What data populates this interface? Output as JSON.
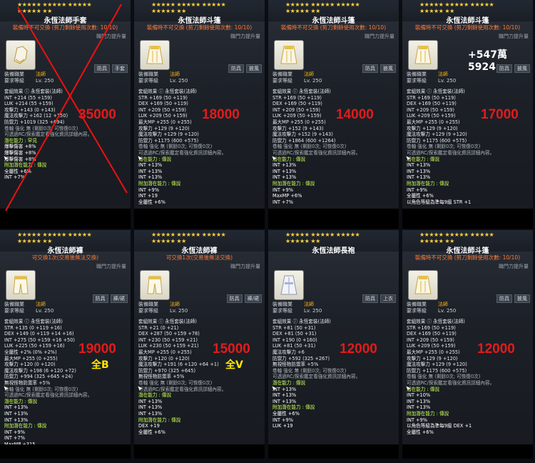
{
  "cards": [
    {
      "stars": "★★★★★ ★★★★★ ★★★★★\n★★★★★ ★★",
      "title": "永恆法師手套",
      "subtitle": "裝備時不可交換 (剪刀剩餘使用次數: 10/10)",
      "upgrade": "職門力提升量",
      "tags": [
        "防具",
        "手套"
      ],
      "req_job_label": "裝備職業",
      "req_job": "法師",
      "req_lv_label": "要求等級",
      "req_lv": "Lv. 250",
      "price": "35000",
      "stat_text": "",
      "allstat_text": "",
      "crossed": true,
      "lines": [
        "套組效果 ⓘ   永恆套裝(法師)",
        "INT +214 (55 +159)",
        "LUK +214 (55 +159)",
        "攻擊力 +143 (0 +143)",
        "魔法攻擊力 +162 (12 +150)",
        "防禦力 +1019 (325 +694)",
        "",
        "卷軸 強化 無 (剩餘0次; 可恢復0次)",
        "可透過RC/探索鑑定看強化資訊詳細內容。",
        "潛在能力 : 罕見",
        "  爆擊傷害 +8%",
        "  爆擊傷害 +8%",
        "  爆擊傷害 +8%",
        "附加潛在能力 : 傳說",
        "  全屬性 +6%",
        "  INT +7%"
      ]
    },
    {
      "stars": "★★★★★ ★★★★★ ★★★★★\n★★★★★ ★★",
      "title": "永恆法師斗篷",
      "subtitle": "裝備時不可交換 (剪刀剩餘使用次數: 10/10)",
      "upgrade": "職門力提升量",
      "tags": [
        "防具",
        "披風"
      ],
      "req_job_label": "裝備職業",
      "req_job": "法師",
      "req_lv_label": "要求等級",
      "req_lv": "Lv. 250",
      "price": "18000",
      "stat_text": "",
      "allstat_text": "",
      "crossed": false,
      "lines": [
        "套組效果 ⓘ   永恆套裝(法師)",
        "STR +169 (50 +119)",
        "DEX +169 (50 +119)",
        "INT +209 (50 +159)",
        "LUK +209 (50 +159)",
        "最大MP +255 (0 +255)",
        "攻擊力 +129 (9 +120)",
        "魔法攻擊力 +129 (9 +120)",
        "防禦力 +1175 (600 +575)",
        "卷軸 強化 無 (剩餘0次; 可恢復0次)",
        "可透過RC/探索鑑定看強化資訊詳細內容。",
        "潛在能力 : 傳說",
        "  INT +13%",
        "  INT +13%",
        "  INT +13%",
        "附加潛在能力 : 傳說",
        "  INT +9%",
        "  INT +19",
        "  全屬性 +6%"
      ]
    },
    {
      "stars": "★★★★★ ★★★★★ ★★★★★\n★★★★★ ★★",
      "title": "永恆法師斗篷",
      "subtitle": "裝備時不可交換 (剪刀剩餘使用次數: 10/10)",
      "upgrade": "職門力提升量",
      "tags": [
        "防具",
        "披風"
      ],
      "req_job_label": "裝備職業",
      "req_job": "法師",
      "req_lv_label": "要求等級",
      "req_lv": "Lv. 250",
      "price": "14000",
      "stat_text": "",
      "allstat_text": "",
      "crossed": false,
      "lines": [
        "套組效果 ⓘ   永恆套裝(法師)",
        "STR +169 (50 +119)",
        "DEX +169 (50 +119)",
        "INT +209 (50 +159)",
        "LUK +209 (50 +159)",
        "最大MP +255 (0 +255)",
        "攻擊力 +152 (9 +143)",
        "魔法攻擊力 +152 (9 +143)",
        "防禦力 +1864 (600 +1264)",
        "卷軸 強化 無 (剩餘0次; 可恢復0次)",
        "可透過RC/探索鑑定看強化資訊詳細內容。",
        "潛在能力 : 傳說",
        "  INT +13%",
        "  INT +13%",
        "  INT +13%",
        "附加潛在能力 : 傳說",
        "  INT +9%",
        "  MaxMP +6%",
        "  INT +7%"
      ]
    },
    {
      "stars": "★★★★★ ★★★★★ ★★★★★\n★★★★★ ★★",
      "title": "永恆法師斗篷",
      "subtitle": "裝備時不可交換 (剪刀剩餘使用次數: 10/10)",
      "upgrade": "職門力提升量",
      "tags": [
        "防具",
        "披風"
      ],
      "req_job_label": "裝備職業",
      "req_job": "法師",
      "req_lv_label": "要求等級",
      "req_lv": "Lv. 250",
      "price": "17000",
      "stat_text": "+547萬5924",
      "allstat_text": "",
      "crossed": false,
      "lines": [
        "套組效果 ⓘ   永恆套裝(法師)",
        "STR +169 (50 +119)",
        "DEX +169 (50 +119)",
        "INT +209 (50 +159)",
        "LUK +209 (50 +159)",
        "最大MP +255 (0 +255)",
        "攻擊力 +129 (9 +120)",
        "魔法攻擊力 +129 (9 +120)",
        "防禦力 +1175 (600 +575)",
        "卷軸 強化 無 (剩餘0次; 可恢復0次)",
        "可透過RC/探索鑑定看強化資訊詳細內容。",
        "潛在能力 : 傳說",
        "  INT +13%",
        "  INT +13%",
        "  INT +13%",
        "附加潛在能力 : 傳說",
        "  INT +9%",
        "  全屬性 +6%",
        "  以角色等級為準每9級 STR +1"
      ]
    },
    {
      "stars": "★★★★★ ★★★★★ ★★★★★\n★★★★★ ★★",
      "title": "永恆法師褲",
      "subtitle": "可交換1次(交易後無法交換)",
      "upgrade": "職門力提升量",
      "tags": [
        "防具",
        "褲/裙"
      ],
      "req_job_label": "裝備職業",
      "req_job": "法師",
      "req_lv_label": "要求等級",
      "req_lv": "Lv. 250",
      "price": "19000",
      "stat_text": "",
      "allstat_text": "全B",
      "crossed": false,
      "lines": [
        "套組效果 ⓘ   永恆套裝(法師)",
        "STR +135 (0 +119 +16)",
        "DEX +149 (0 +119 +14 +16)",
        "INT +275 (50 +159 +16 +50)",
        "LUK +225 (50 +159 +16)",
        "全屬性 +2% (0% +2%)",
        "最大MP +255 (0 +255)",
        "攻擊力 +120 (0 +120)",
        "魔法攻擊力 +198 (6 +120 +72)",
        "防禦力 +994 (325 +645 +24)",
        "無視怪物防禦率 +5%",
        "卷軸 強化 無 (剩餘0次; 可恢復0次)",
        "可透過RC/探索鑑定看強化資訊詳細內容。",
        "潛在能力 : 傳說",
        "  INT +13%",
        "  INT +13%",
        "  INT +13%",
        "附加潛在能力 : 傳說",
        "  INT +9%",
        "  INT +7%",
        "  MaxMP +315"
      ]
    },
    {
      "stars": "★★★★★ ★★★★★ ★★★★★\n★★★★★ ★★",
      "title": "永恆法師褲",
      "subtitle": "可交換1次(交易後無法交換)",
      "upgrade": "職門力提升量",
      "tags": [
        "防具",
        "褲/裙"
      ],
      "req_job_label": "裝備職業",
      "req_job": "法師",
      "req_lv_label": "要求等級",
      "req_lv": "Lv. 250",
      "price": "15000",
      "stat_text": "",
      "allstat_text": "全V",
      "crossed": false,
      "lines": [
        "套組效果 ⓘ   永恆套裝(法師)",
        "STR +21 (0 +21)",
        "DEX +287 (50 +159 +78)",
        "INT +230 (50 +159 +21)",
        "LUK +230 (50 +159 +21)",
        "最大MP +255 (0 +255)",
        "攻擊力 +120 (0 +120)",
        "魔法攻擊力 +191 (6 +120 +64 +1)",
        "防禦力 +970 (325 +645)",
        "無視怪物防禦率 +5%",
        "卷軸 強化 無 (剩餘0次; 可恢復0次)",
        "可透過RC/探索鑑定看強化資訊詳細內容。",
        "潛在能力 : 傳說",
        "  INT +13%",
        "  INT +13%",
        "  INT +13%",
        "附加潛在能力 : 傳說",
        "  DEX +19",
        "  全屬性 +6%"
      ]
    },
    {
      "stars": "★★★★★ ★★★★★ ★★★★★\n★★★★★ ★★",
      "title": "永恆法師長袍",
      "subtitle": "",
      "upgrade": "",
      "tags": [
        "防具",
        "上衣"
      ],
      "req_job_label": "裝備職業",
      "req_job": "法師",
      "req_lv_label": "要求等級",
      "req_lv": "Lv. 250",
      "price": "12000",
      "stat_text": "",
      "allstat_text": "",
      "crossed": false,
      "lines": [
        "套組效果 ⓘ   永恆套裝(法師)",
        "STR +81 (50 +31)",
        "DEX +81 (50 +31)",
        "INT +190 (0 +160)",
        "LUK +81 (50 +31)",
        "魔法攻擊力 +6",
        "防禦力 +592 (325 +267)",
        "無視怪物防禦率 +5%",
        "卷軸 強化 無 (剩餘0次; 可恢復0次)",
        "可透過RC/探索鑑定看強化資訊詳細內容。",
        "潛在能力 : 傳說",
        "  INT +13%",
        "  INT +13%",
        "  INT +13%",
        "附加潛在能力 : 傳說",
        "  全屬性 +6%",
        "  INT +9%",
        "  LUK +19"
      ]
    },
    {
      "stars": "★★★★★ ★★★★★ ★★★★★\n★★★★★ ★★",
      "title": "永恆法師斗篷",
      "subtitle": "裝備時不可交換 (剪刀剩餘使用次數: 10/10)",
      "upgrade": "職門力提升量",
      "tags": [
        "防具",
        "披風"
      ],
      "req_job_label": "裝備職業",
      "req_job": "法師",
      "req_lv_label": "要求等級",
      "req_lv": "Lv. 250",
      "price": "12000",
      "stat_text": "",
      "allstat_text": "",
      "crossed": false,
      "lines": [
        "套組效果 ⓘ   永恆套裝(法師)",
        "STR +169 (50 +119)",
        "DEX +169 (50 +119)",
        "INT +209 (50 +159)",
        "LUK +209 (50 +159)",
        "最大MP +255 (0 +255)",
        "攻擊力 +129 (9 +120)",
        "魔法攻擊力 +129 (9 +120)",
        "防禦力 +1175 (600 +575)",
        "卷軸 強化 無 (剩餘0次; 可恢復0次)",
        "可透過RC/探索鑑定看強化資訊詳細內容。",
        "潛在能力 : 傳說",
        "  INT +10%",
        "  INT +13%",
        "  INT +13%",
        "附加潛在能力 : 傳說",
        "  INT +9%",
        "  以角色等級為準每9級 DEX +1",
        "  全屬性 +6%"
      ]
    }
  ]
}
